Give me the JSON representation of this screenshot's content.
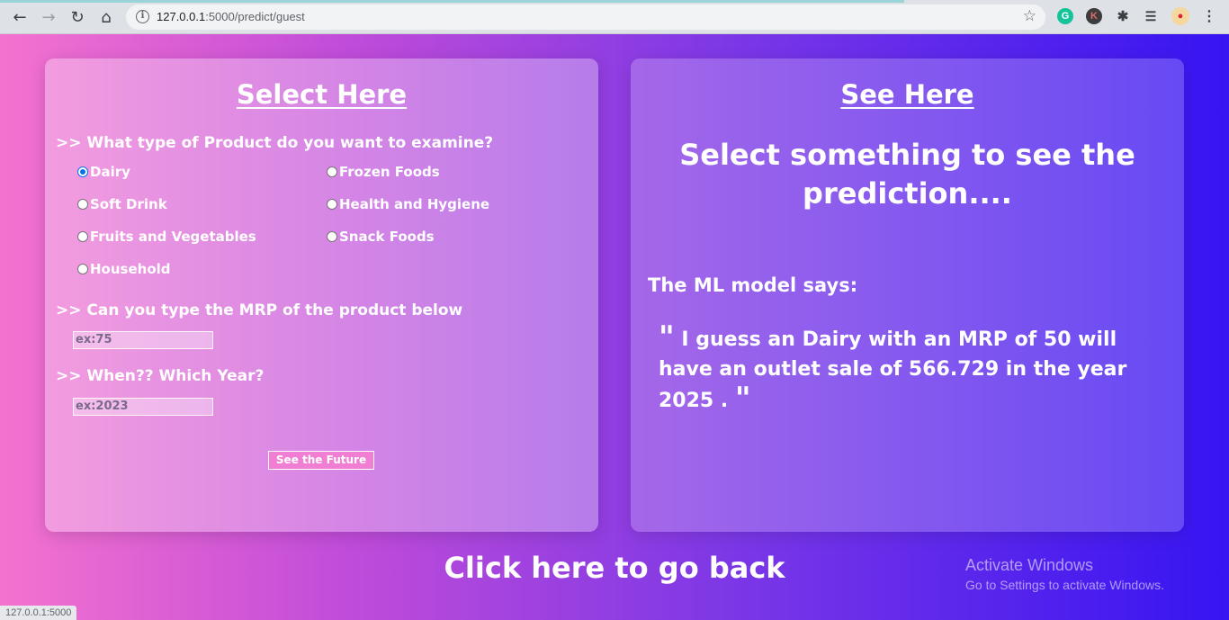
{
  "browser": {
    "url_host": "127.0.0.1",
    "url_path": ":5000/predict/guest",
    "status_url": "127.0.0.1:5000",
    "icons": [
      "back-arrow-icon",
      "forward-arrow-icon",
      "reload-icon",
      "home-icon",
      "info-icon",
      "star-icon",
      "grammarly-icon",
      "k-extension-icon",
      "extensions-puzzle-icon",
      "reading-list-icon",
      "profile-avatar",
      "menu-kebab-icon"
    ]
  },
  "left_card": {
    "title": "Select Here",
    "q1": ">> What type of Product do you want to examine?",
    "options": [
      {
        "label": "Dairy",
        "checked": true
      },
      {
        "label": "Frozen Foods",
        "checked": false
      },
      {
        "label": "Soft Drink",
        "checked": false
      },
      {
        "label": "Health and Hygiene",
        "checked": false
      },
      {
        "label": "Fruits and Vegetables",
        "checked": false
      },
      {
        "label": "Snack Foods",
        "checked": false
      },
      {
        "label": "Household",
        "checked": false
      }
    ],
    "q2": ">> Can you type the MRP of the product below",
    "mrp_placeholder": "ex:75",
    "q3": ">> When?? Which Year?",
    "year_placeholder": "ex:2023",
    "submit_label": "See the Future"
  },
  "right_card": {
    "title": "See Here",
    "prompt": "Select something to see the prediction....",
    "ml_label": "The ML model says:",
    "quote_open": "\"",
    "quote_text": "I guess an Dairy with an MRP of 50 will have an outlet sale of 566.729 in the year 2025 .",
    "quote_close": "\""
  },
  "go_back": "Click here to go back",
  "watermark": {
    "line1": "Activate Windows",
    "line2": "Go to Settings to activate Windows."
  }
}
